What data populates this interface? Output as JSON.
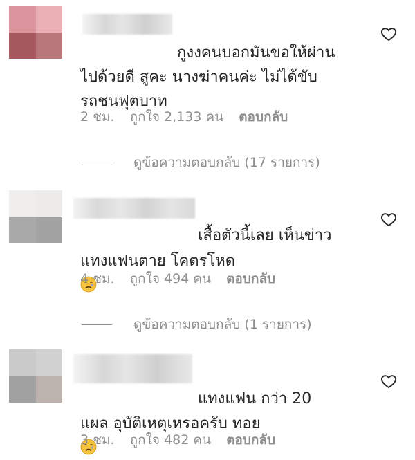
{
  "comments": [
    {
      "text_line1": "กูงงคนบอกมันขอให้ผ่าน",
      "text_line2": "ไปด้วยดี สูคะ นางฆ่าคนค่ะ ไม่ได้ขับ",
      "text_line3": "รถชนฟุตบาท",
      "time": "2 ชม.",
      "likes": "ถูกใจ 2,133 คน",
      "reply_label": "ตอบกลับ",
      "view_replies": "ดูข้อความตอบกลับ (17 รายการ)",
      "avatar_colors": [
        "#d9959b",
        "#eab0b3",
        "#a5595f",
        "#b9777b"
      ]
    },
    {
      "text_line1": "เสื้อตัวนี้เลย เห็นข่าว",
      "text_line2": "แทงแฟนตาย โคตรโหด",
      "time": "4 ชม.",
      "likes": "ถูกใจ 494 คน",
      "reply_label": "ตอบกลับ",
      "view_replies": "ดูข้อความตอบกลับ (1 รายการ)",
      "avatar_colors": [
        "#f0eeec",
        "#eeeceb",
        "#a9a9a9",
        "#a3a3a3"
      ]
    },
    {
      "text_line1": "แทงแฟน กว่า 20",
      "text_line2": "แผล อุบัติเหตุเหรอครับ ทอย",
      "time": "3 ชม.",
      "likes": "ถูกใจ 482 คน",
      "reply_label": "ตอบกลับ",
      "avatar_colors": [
        "#cacaca",
        "#d1d1d1",
        "#a1a1a1",
        "#bcb2ae"
      ]
    }
  ],
  "icons": {
    "heart": "heart-outline-icon",
    "emoji": "crying-face-emoji"
  },
  "colors": {
    "text": "#262626",
    "secondary": "#8e8e8e"
  }
}
